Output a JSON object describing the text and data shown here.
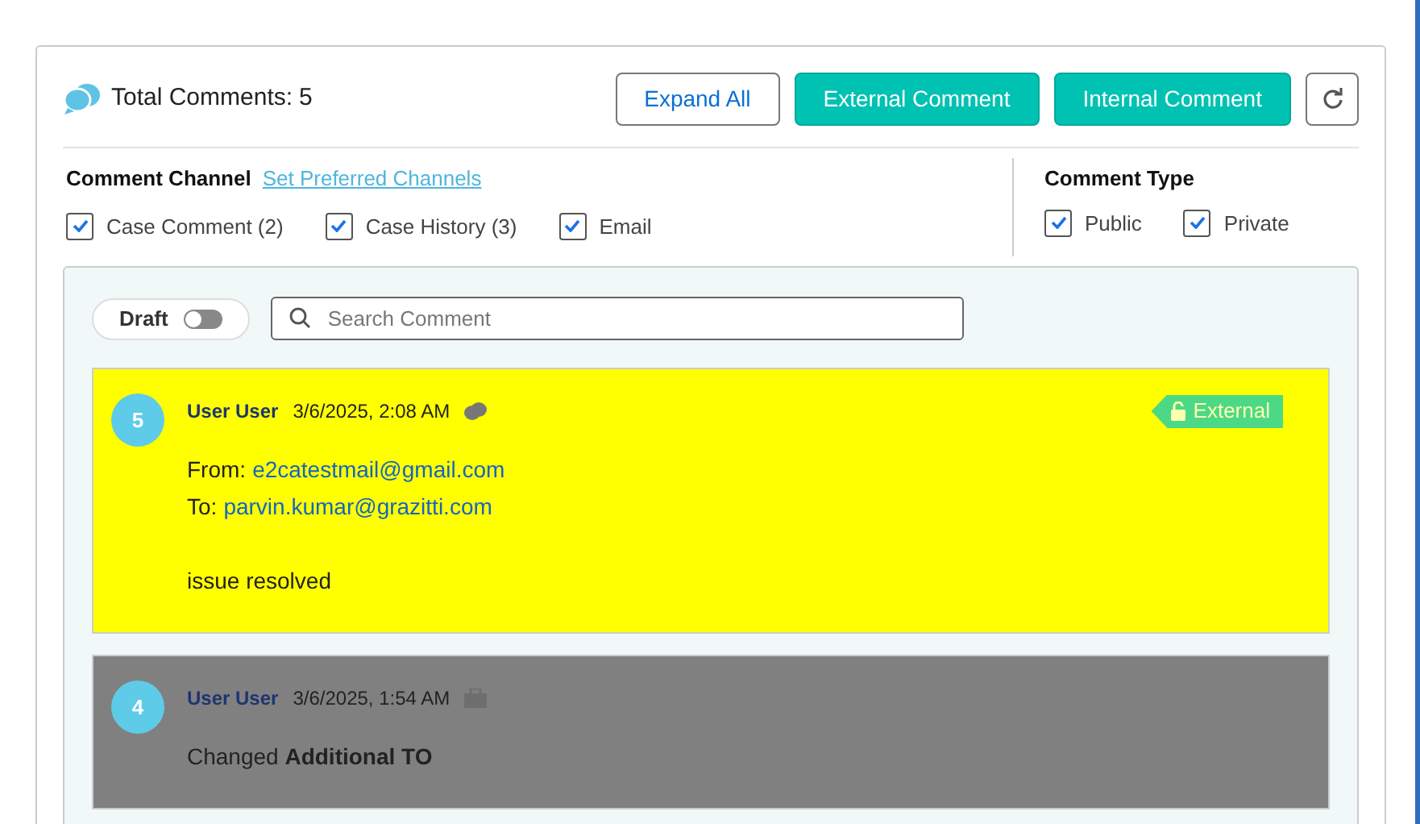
{
  "header": {
    "title": "Total Comments:",
    "count": "5"
  },
  "actions": [
    {
      "label": "Expand All",
      "kind": "outline"
    },
    {
      "label": "External Comment",
      "kind": "primary"
    },
    {
      "label": "Internal Comment",
      "kind": "primary"
    }
  ],
  "channels": {
    "title": "Comment Channel",
    "link": "Set Preferred Channels",
    "options": [
      {
        "label": "Case Comment (2)",
        "checked": true
      },
      {
        "label": "Case History (3)",
        "checked": true
      },
      {
        "label": "Email",
        "checked": true
      }
    ]
  },
  "comment_type": {
    "title": "Comment Type",
    "options": [
      {
        "label": "Public",
        "checked": true
      },
      {
        "label": "Private",
        "checked": true
      }
    ]
  },
  "draft": {
    "label": "Draft",
    "on": false
  },
  "search": {
    "placeholder": "Search Comment"
  },
  "comments": [
    {
      "number": "5",
      "author": "User User",
      "time": "3/6/2025, 2:08 AM",
      "kind": "email",
      "badge": "External",
      "lines": [
        {
          "kind": "address",
          "label": "From:",
          "value": "e2catestmail@gmail.com"
        },
        {
          "kind": "address",
          "label": "To:",
          "value": "parvin.kumar@grazitti.com"
        },
        {
          "kind": "blank"
        },
        {
          "kind": "text",
          "text": "issue resolved"
        }
      ]
    },
    {
      "number": "4",
      "author": "User User",
      "time": "3/6/2025, 1:54 AM",
      "kind": "history",
      "lines": [
        {
          "kind": "text",
          "text": "Changed **Additional TO**"
        }
      ]
    }
  ]
}
